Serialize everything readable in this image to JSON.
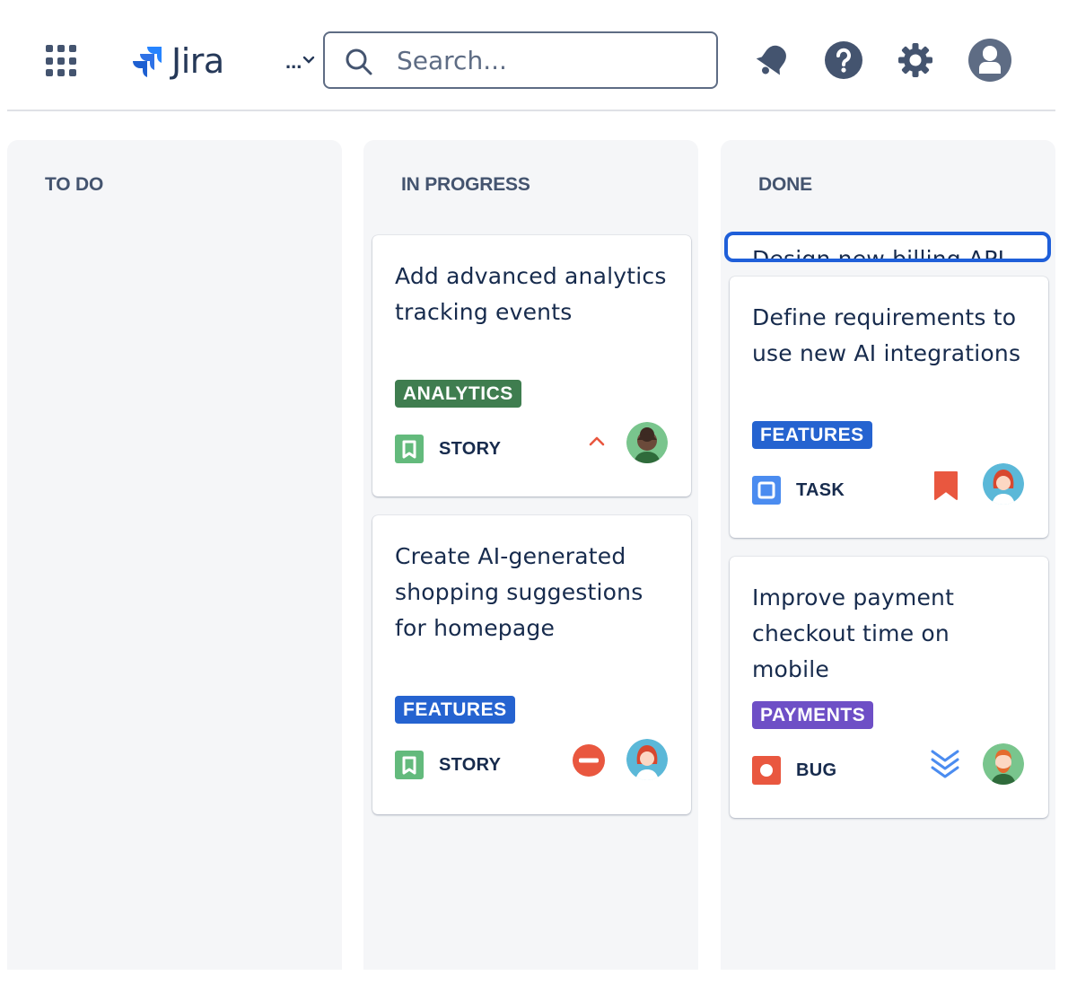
{
  "app": {
    "name": "Jira",
    "more_label": "...",
    "search": {
      "placeholder": "Search..."
    }
  },
  "columns": [
    {
      "title": "TO DO",
      "cards": []
    },
    {
      "title": "IN PROGRESS",
      "cards": [
        {
          "summary": "Add advanced analytics tracking events",
          "label": "ANALYTICS",
          "label_color": "#3f7d4f",
          "type": "STORY",
          "type_icon": "story-icon",
          "priority_icon": "priority-medium-icon"
        },
        {
          "summary": "Create AI-generated shopping suggestions for homepage",
          "label": "FEATURES",
          "label_color": "#2563d0",
          "type": "STORY",
          "type_icon": "story-icon",
          "priority_icon": "priority-blocker-icon"
        }
      ]
    },
    {
      "title": "DONE",
      "dragging_card": {
        "summary": "Design new billing API"
      },
      "cards": [
        {
          "summary": "Define requirements to use new AI integrations",
          "label": "FEATURES",
          "label_color": "#2563d0",
          "type": "TASK",
          "type_icon": "task-icon",
          "priority_icon": "priority-flag-icon"
        },
        {
          "summary": "Improve payment checkout time on mobile",
          "label": "PAYMENTS",
          "label_color": "#6e4fc6",
          "type": "BUG",
          "type_icon": "bug-icon",
          "priority_icon": "priority-lowest-icon"
        }
      ]
    }
  ],
  "colors": {
    "story": "#63ba7c",
    "task": "#4b8cf0",
    "bug": "#e9573f",
    "priority_red": "#e9573f",
    "priority_blue": "#4b8cf0",
    "focus_ring": "#1f5fd9"
  }
}
